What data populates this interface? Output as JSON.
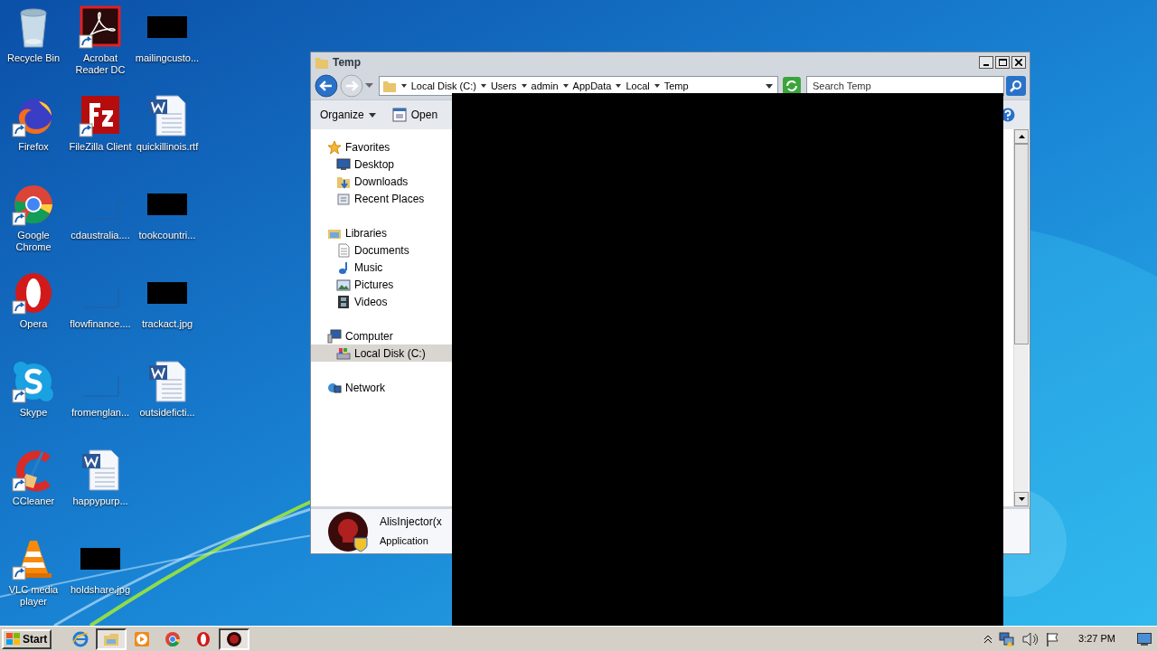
{
  "desktop": {
    "icons": [
      {
        "label": "Recycle Bin",
        "kind": "recycle",
        "shortcut": false
      },
      {
        "label": "Firefox",
        "kind": "firefox",
        "shortcut": true
      },
      {
        "label": "Google Chrome",
        "kind": "chrome",
        "shortcut": true
      },
      {
        "label": "Opera",
        "kind": "opera",
        "shortcut": true
      },
      {
        "label": "Skype",
        "kind": "skype",
        "shortcut": true
      },
      {
        "label": "CCleaner",
        "kind": "ccleaner",
        "shortcut": true
      },
      {
        "label": "VLC media player",
        "kind": "vlc",
        "shortcut": true
      },
      {
        "label": "Acrobat Reader DC",
        "kind": "acrobat",
        "shortcut": true
      },
      {
        "label": "FileZilla Client",
        "kind": "filezilla",
        "shortcut": true
      },
      {
        "label": "cdaustralia....",
        "kind": "blank",
        "shortcut": false
      },
      {
        "label": "flowfinance....",
        "kind": "blank",
        "shortcut": false
      },
      {
        "label": "fromenglan...",
        "kind": "blank",
        "shortcut": false
      },
      {
        "label": "happypurp...",
        "kind": "word",
        "shortcut": false
      },
      {
        "label": "holdshare.jpg",
        "kind": "dark",
        "shortcut": false
      },
      {
        "label": "mailingcusto...",
        "kind": "dark",
        "shortcut": false
      },
      {
        "label": "quickillinois.rtf",
        "kind": "word",
        "shortcut": false
      },
      {
        "label": "tookcountri...",
        "kind": "dark",
        "shortcut": false
      },
      {
        "label": "trackact.jpg",
        "kind": "dark",
        "shortcut": false
      },
      {
        "label": "outsideficti...",
        "kind": "word",
        "shortcut": false
      }
    ]
  },
  "window": {
    "title": "Temp",
    "address": [
      "Local Disk (C:)",
      "Users",
      "admin",
      "AppData",
      "Local",
      "Temp"
    ],
    "search": {
      "placeholder": "Search Temp"
    },
    "toolbar": [
      {
        "label": "Organize",
        "kind": "menu"
      },
      {
        "label": "Open",
        "kind": "open"
      }
    ],
    "nav": [
      {
        "label": "Favorites",
        "kind": "star",
        "selected": false,
        "children": [
          {
            "label": "Desktop",
            "kind": "desktop",
            "selected": false
          },
          {
            "label": "Downloads",
            "kind": "downloads",
            "selected": false
          },
          {
            "label": "Recent Places",
            "kind": "recent",
            "selected": false
          }
        ]
      },
      {
        "label": "Libraries",
        "kind": "library",
        "selected": false,
        "children": [
          {
            "label": "Documents",
            "kind": "documents",
            "selected": false
          },
          {
            "label": "Music",
            "kind": "music",
            "selected": false
          },
          {
            "label": "Pictures",
            "kind": "pictures",
            "selected": false
          },
          {
            "label": "Videos",
            "kind": "videos",
            "selected": false
          }
        ]
      },
      {
        "label": "Computer",
        "kind": "computer",
        "selected": false,
        "children": [
          {
            "label": "Local Disk (C:)",
            "kind": "drive",
            "selected": true
          }
        ]
      },
      {
        "label": "Network",
        "kind": "network",
        "selected": false
      }
    ],
    "details": {
      "name": "AlisInjector(x",
      "type": "Application"
    }
  },
  "taskbar": {
    "start": "Start",
    "apps": [
      {
        "kind": "ie",
        "active": false
      },
      {
        "kind": "explorer",
        "active": true
      },
      {
        "kind": "media",
        "active": false
      },
      {
        "kind": "chrome",
        "active": false
      },
      {
        "kind": "opera",
        "active": false
      },
      {
        "kind": "redapp",
        "active": true
      }
    ],
    "clock": "3:27 PM"
  }
}
